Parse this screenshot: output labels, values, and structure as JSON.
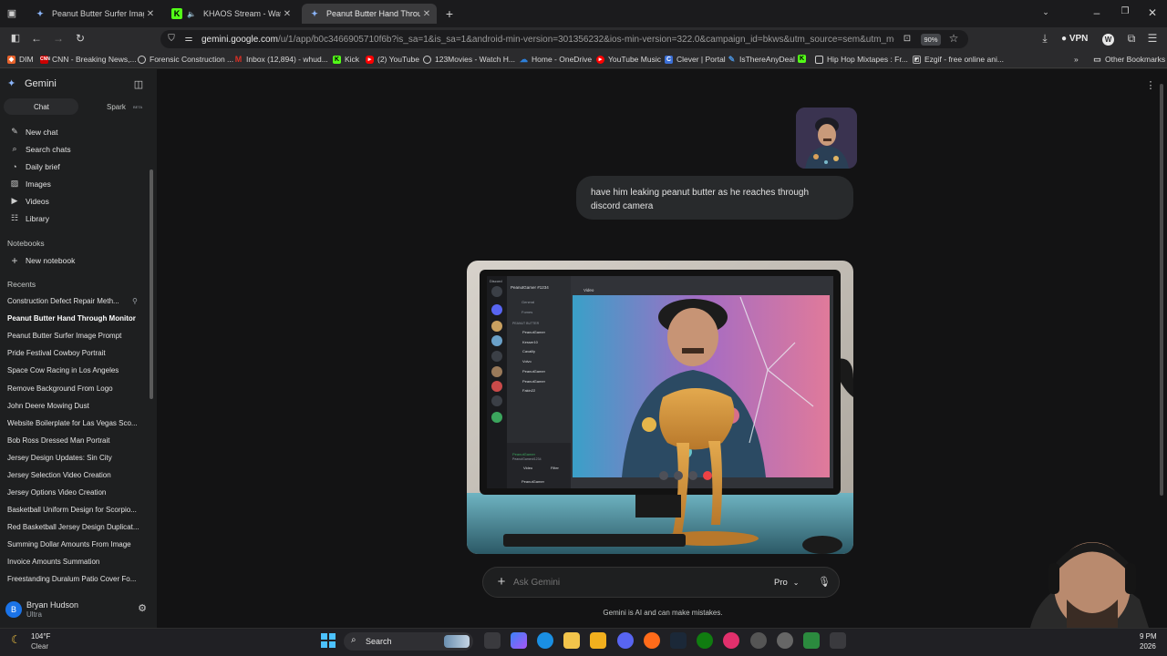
{
  "tabs": [
    {
      "label": "Peanut Butter Surfer Image Pro",
      "icon": "gemini-icon",
      "active": false
    },
    {
      "label": "KHAOS Stream - Watch Live",
      "icon": "kick-icon",
      "active": false
    },
    {
      "label": "Peanut Butter Hand Through M",
      "icon": "gemini-icon",
      "active": true
    }
  ],
  "toolbar": {
    "url_host": "gemini.google.com",
    "url_prefix": "",
    "url_path": "/u/1/app/b0c3466905710f6b?is_sa=1&is_sa=1&android-min-version=301356232&ios-min-version=322.0&campaign_id=bkws&utm_source=sem&utm_medium=paid-",
    "zoom": "90%",
    "vpn_label": "VPN"
  },
  "bookmarks": [
    {
      "label": "DIM",
      "icon": "dim-icon",
      "color": "#e8632c"
    },
    {
      "label": "CNN - Breaking News,...",
      "icon": "cnn-icon",
      "color": "#cc0000"
    },
    {
      "label": "Forensic Construction ...",
      "icon": "globe-icon",
      "color": "#888888"
    },
    {
      "label": "Inbox (12,894) - whud...",
      "icon": "gmail-icon",
      "color": "#d93025"
    },
    {
      "label": "Kick",
      "icon": "kick-icon",
      "color": "#53fc18"
    },
    {
      "label": "(2) YouTube",
      "icon": "youtube-icon",
      "color": "#ff0000"
    },
    {
      "label": "123Movies - Watch H...",
      "icon": "globe-icon",
      "color": "#888888"
    },
    {
      "label": "Home - OneDrive",
      "icon": "onedrive-icon",
      "color": "#2d7fd8"
    },
    {
      "label": "YouTube Music",
      "icon": "youtube-music-icon",
      "color": "#ff0000"
    },
    {
      "label": "Clever | Portal",
      "icon": "clever-icon",
      "color": "#3b6fd6"
    },
    {
      "label": "IsThereAnyDeal",
      "icon": "deal-icon",
      "color": "#4a90d9"
    },
    {
      "label": "Hip Hop Mixtapes : Fr...",
      "icon": "kick-icon",
      "color": "#53fc18"
    },
    {
      "label": "Ezgif - free online ani...",
      "icon": "ezgif-icon",
      "color": "#aaaaaa"
    }
  ],
  "other_bookmarks": "Other Bookmarks",
  "sidebar": {
    "app_title": "Gemini",
    "tab_chat": "Chat",
    "tab_spark": "Spark",
    "spark_badge": "BETA",
    "nav": [
      {
        "label": "New chat",
        "icon": "new-chat-icon"
      },
      {
        "label": "Search chats",
        "icon": "search-icon"
      },
      {
        "label": "Daily brief",
        "icon": "brief-icon"
      },
      {
        "label": "Images",
        "icon": "image-icon"
      },
      {
        "label": "Videos",
        "icon": "video-icon"
      },
      {
        "label": "Library",
        "icon": "library-icon"
      }
    ],
    "notebooks_header": "Notebooks",
    "new_notebook": "New notebook",
    "recents_header": "Recents",
    "recents": [
      "Construction Defect Repair Meth...",
      "Peanut Butter Hand Through Monitor",
      "Peanut Butter Surfer Image Prompt",
      "Pride Festival Cowboy Portrait",
      "Space Cow Racing in Los Angeles",
      "Remove Background From Logo",
      "John Deere Mowing Dust",
      "Website Boilerplate for Las Vegas Sco...",
      "Bob Ross Dressed Man Portrait",
      "Jersey Design Updates: Sin City",
      "Jersey Selection Video Creation",
      "Jersey Options Video Creation",
      "Basketball Uniform Design for Scorpio...",
      "Red Basketball Jersey Design Duplicat...",
      "Summing Dollar Amounts From Image",
      "Invoice Amounts Summation",
      "Freestanding Duralum Patio Cover Fo..."
    ],
    "active_recent_index": 1,
    "user_name": "Bryan Hudson",
    "user_plan": "Ultra",
    "user_initial": "B"
  },
  "chat": {
    "user_prompt": "have him leaking peanut butter as he reaches through discord camera",
    "ask_placeholder": "Ask Gemini",
    "model_label": "Pro",
    "disclaimer": "Gemini is AI and can make mistakes."
  },
  "discord_mock": {
    "title": "Discord",
    "username": "PeanutGamer #1234",
    "video_label": "Video",
    "channels": [
      "General",
      "Fomes"
    ],
    "voice_header": "PEANUT BUTTER",
    "members": [
      "PeanutGamer",
      "Kesser10",
      "Cavalily",
      "Volvo",
      "PeanutGamer",
      "PeanutGamer",
      "Fakin22"
    ],
    "footer_user": "PeanutGamer",
    "footer_sub": "PeanutGamer#1234",
    "btn_video": "Video",
    "btn_filter": "Filter"
  },
  "taskbar": {
    "weather_temp": "104°F",
    "weather_desc": "Clear",
    "search_label": "Search",
    "time_partial": "9 PM",
    "date_partial": "2026"
  }
}
